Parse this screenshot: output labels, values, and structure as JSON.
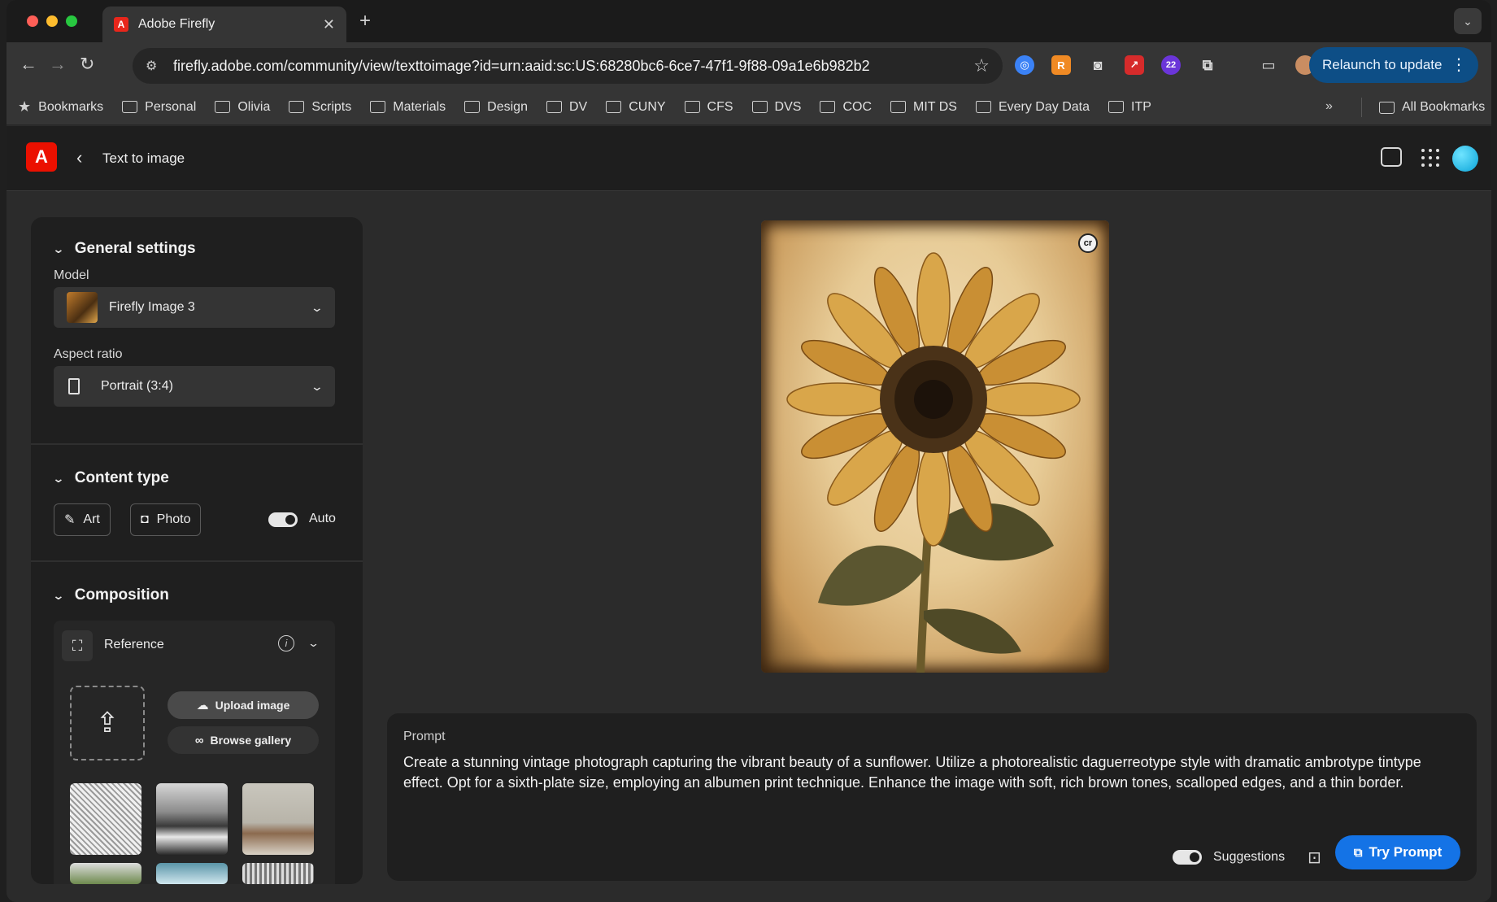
{
  "browser": {
    "tab_title": "Adobe Firefly",
    "url": "firefly.adobe.com/community/view/texttoimage?id=urn:aaid:sc:US:68280bc6-6ce7-47f1-9f88-09a1e6b982b2",
    "extension_badge": "22",
    "relaunch_label": "Relaunch to update"
  },
  "bookmarks": {
    "items": [
      "Bookmarks",
      "Personal",
      "Olivia",
      "Scripts",
      "Materials",
      "Design",
      "DV",
      "CUNY",
      "CFS",
      "DVS",
      "COC",
      "MIT DS",
      "Every Day Data",
      "ITP"
    ],
    "all_label": "All Bookmarks"
  },
  "app": {
    "title": "Text to image"
  },
  "general_settings": {
    "heading": "General settings",
    "model_label": "Model",
    "model_value": "Firefly Image 3",
    "aspect_label": "Aspect ratio",
    "aspect_value": "Portrait (3:4)"
  },
  "content_type": {
    "heading": "Content type",
    "art_label": "Art",
    "photo_label": "Photo",
    "auto_label": "Auto"
  },
  "composition": {
    "heading": "Composition",
    "reference_label": "Reference",
    "upload_label": "Upload image",
    "browse_label": "Browse gallery"
  },
  "image": {
    "badge": "cr"
  },
  "prompt": {
    "label": "Prompt",
    "text": "Create a stunning vintage photograph capturing the vibrant beauty of a sunflower. Utilize a photorealistic daguerreotype style with dramatic ambrotype tintype effect. Opt for a sixth-plate size, employing an albumen print technique. Enhance the image with soft, rich brown tones, scalloped edges, and a thin border.",
    "suggestions_label": "Suggestions",
    "try_label": "Try Prompt"
  },
  "colors": {
    "accent": "#1473e6",
    "adobe_red": "#eb1000"
  }
}
